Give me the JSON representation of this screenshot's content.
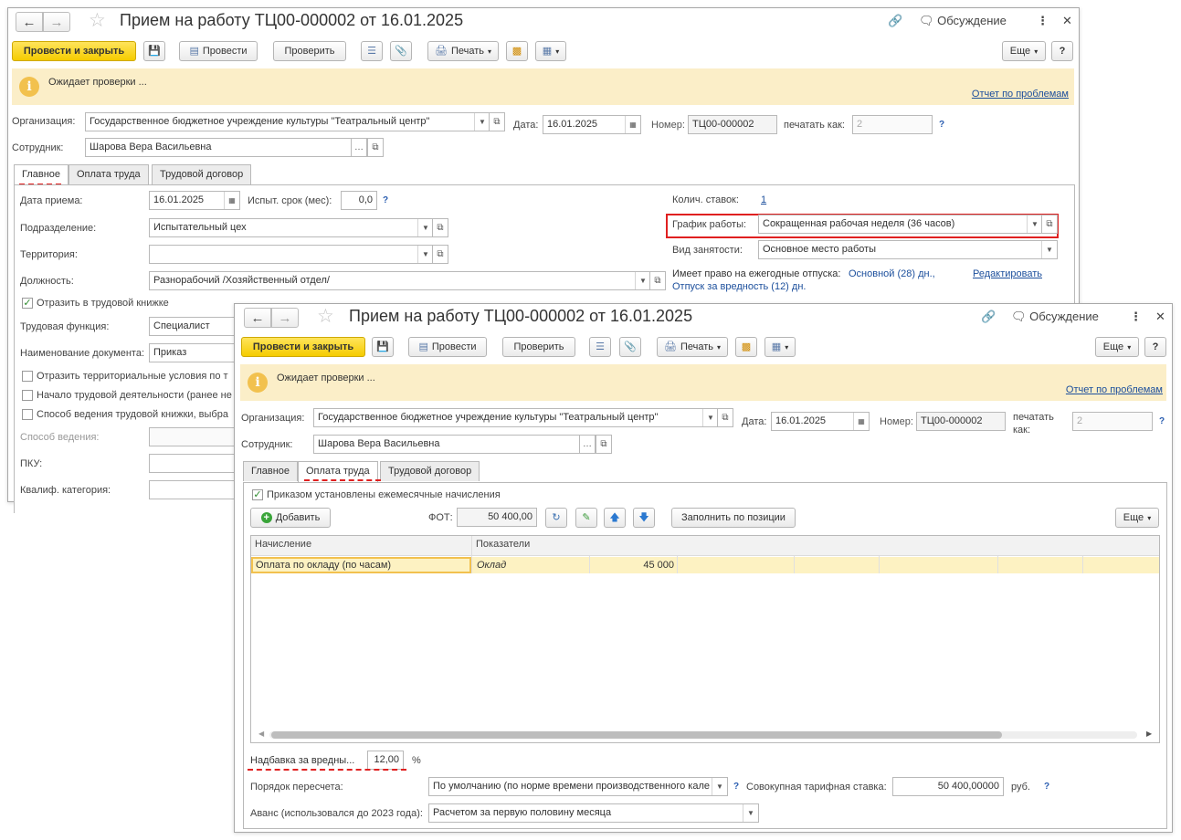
{
  "colors": {
    "accent": "#f5cc00",
    "banner": "#fbeec8",
    "highlight": "#e02020",
    "link": "#1c4f9c",
    "selection": "#fdf2c2"
  },
  "icons": {
    "back": "arrow-left-icon",
    "forward": "arrow-right-icon",
    "favorite": "star-icon",
    "link": "link-icon",
    "discussion": "speech-bubble-icon",
    "more": "kebab-icon",
    "close": "close-icon",
    "info": "info-icon"
  },
  "window1": {
    "title": "Прием на работу ТЦ00-000002 от 16.01.2025",
    "discussion": "Обсуждение",
    "toolbar": {
      "post_close": "Провести и закрыть",
      "post": "Провести",
      "check": "Проверить",
      "print": "Печать",
      "more": "Еще",
      "help": "?"
    },
    "banner": {
      "text": "Ожидает проверки ...",
      "link": "Отчет по проблемам"
    },
    "org_label": "Организация:",
    "org_value": "Государственное бюджетное учреждение культуры \"Театральный центр\"",
    "date_label": "Дата:",
    "date_value": "16.01.2025",
    "number_label": "Номер:",
    "number_value": "ТЦ00-000002",
    "print_as_label": "печатать как:",
    "print_as_value": "2",
    "employee_label": "Сотрудник:",
    "employee_value": "Шарова Вера Васильевна",
    "tabs": [
      "Главное",
      "Оплата труда",
      "Трудовой договор"
    ],
    "main": {
      "hire_date_label": "Дата приема:",
      "hire_date_value": "16.01.2025",
      "probation_label": "Испыт. срок (мес):",
      "probation_value": "0,0",
      "dept_label": "Подразделение:",
      "dept_value": "Испытательный цех",
      "territory_label": "Территория:",
      "territory_value": "",
      "position_label": "Должность:",
      "position_value": "Разнорабочий /Хозяйственный отдел/",
      "workbook_check": "Отразить в трудовой книжке",
      "labor_func_label": "Трудовая функция:",
      "labor_func_value": "Специалист",
      "doc_name_label": "Наименование документа:",
      "doc_name_value": "Приказ",
      "terr_conditions": "Отразить территориальные условия по т",
      "work_start": "Начало трудовой деятельности (ранее не",
      "workbook_method": "Способ ведения трудовой книжки, выбра",
      "method_label": "Способ ведения:",
      "pku_label": "ПКУ:",
      "qual_label": "Квалиф. категория:",
      "rates_label": "Колич. ставок:",
      "rates_value": "1",
      "schedule_label": "График работы:",
      "schedule_value": "Сокращенная рабочая неделя (36 часов)",
      "employment_label": "Вид занятости:",
      "employment_value": "Основное место работы",
      "vacation_label": "Имеет право на ежегодные отпуска:",
      "vacation_value1": "Основной (28) дн.,",
      "vacation_value2": "Отпуск за вредность (12) дн.",
      "edit_link": "Редактировать"
    }
  },
  "window2": {
    "title": "Прием на работу ТЦ00-000002 от 16.01.2025",
    "discussion": "Обсуждение",
    "toolbar": {
      "post_close": "Провести и закрыть",
      "post": "Провести",
      "check": "Проверить",
      "print": "Печать",
      "more": "Еще",
      "help": "?"
    },
    "banner": {
      "text": "Ожидает проверки ...",
      "link": "Отчет по проблемам"
    },
    "org_label": "Организация:",
    "org_value": "Государственное бюджетное учреждение культуры \"Театральный центр\"",
    "date_label": "Дата:",
    "date_value": "16.01.2025",
    "number_label": "Номер:",
    "number_value": "ТЦ00-000002",
    "print_as_label1": "печатать",
    "print_as_label2": "как:",
    "print_as_value": "2",
    "employee_label": "Сотрудник:",
    "employee_value": "Шарова Вера Васильевна",
    "tabs": [
      "Главное",
      "Оплата труда",
      "Трудовой договор"
    ],
    "pay": {
      "monthly_check": "Приказом установлены ежемесячные начисления",
      "add_button": "Добавить",
      "fot_label": "ФОТ:",
      "fot_value": "50 400,00",
      "fill_button": "Заполнить по позиции",
      "more_button": "Еще",
      "columns": [
        "Начисление",
        "Показатели"
      ],
      "rows": [
        {
          "accrual": "Оплата по окладу (по часам)",
          "indicator": "Оклад",
          "value": "45 000"
        }
      ],
      "hazard_label": "Надбавка за вредны...",
      "hazard_value": "12,00",
      "hazard_unit": "%",
      "recalc_label": "Порядок пересчета:",
      "recalc_value": "По умолчанию (по норме времени производственного кале",
      "total_rate_label": "Совокупная тарифная ставка:",
      "total_rate_value": "50 400,00000",
      "total_rate_unit": "руб.",
      "advance_label": "Аванс (использовался до 2023 года):",
      "advance_value": "Расчетом за первую половину месяца"
    }
  }
}
